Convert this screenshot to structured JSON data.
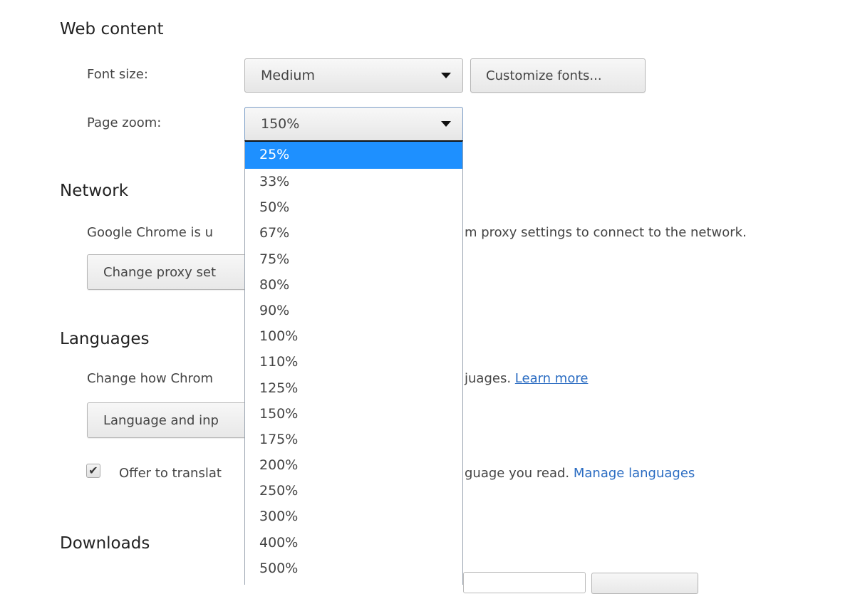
{
  "web_content": {
    "title": "Web content",
    "font_size_label": "Font size:",
    "font_size_value": "Medium",
    "customize_fonts_label": "Customize fonts...",
    "page_zoom_label": "Page zoom:",
    "page_zoom_value": "150%",
    "page_zoom_options": [
      "25%",
      "33%",
      "50%",
      "67%",
      "75%",
      "80%",
      "90%",
      "100%",
      "110%",
      "125%",
      "150%",
      "175%",
      "200%",
      "250%",
      "300%",
      "400%",
      "500%"
    ],
    "highlighted_option": "25%"
  },
  "network": {
    "title": "Network",
    "description_left": "Google Chrome is u",
    "description_right": "m proxy settings to connect to the network.",
    "change_proxy_label": "Change proxy set"
  },
  "languages": {
    "title": "Languages",
    "description_left": "Change how Chrom",
    "description_right": "juages.",
    "learn_more_link": "Learn more",
    "language_input_label": "Language and inp",
    "translate_checkbox_checked": true,
    "translate_left": "Offer to translat",
    "translate_right": "guage you read.",
    "manage_languages_link": "Manage languages"
  },
  "downloads": {
    "title": "Downloads"
  },
  "colors": {
    "highlight": "#1e90ff",
    "link": "#2a6cc2"
  }
}
